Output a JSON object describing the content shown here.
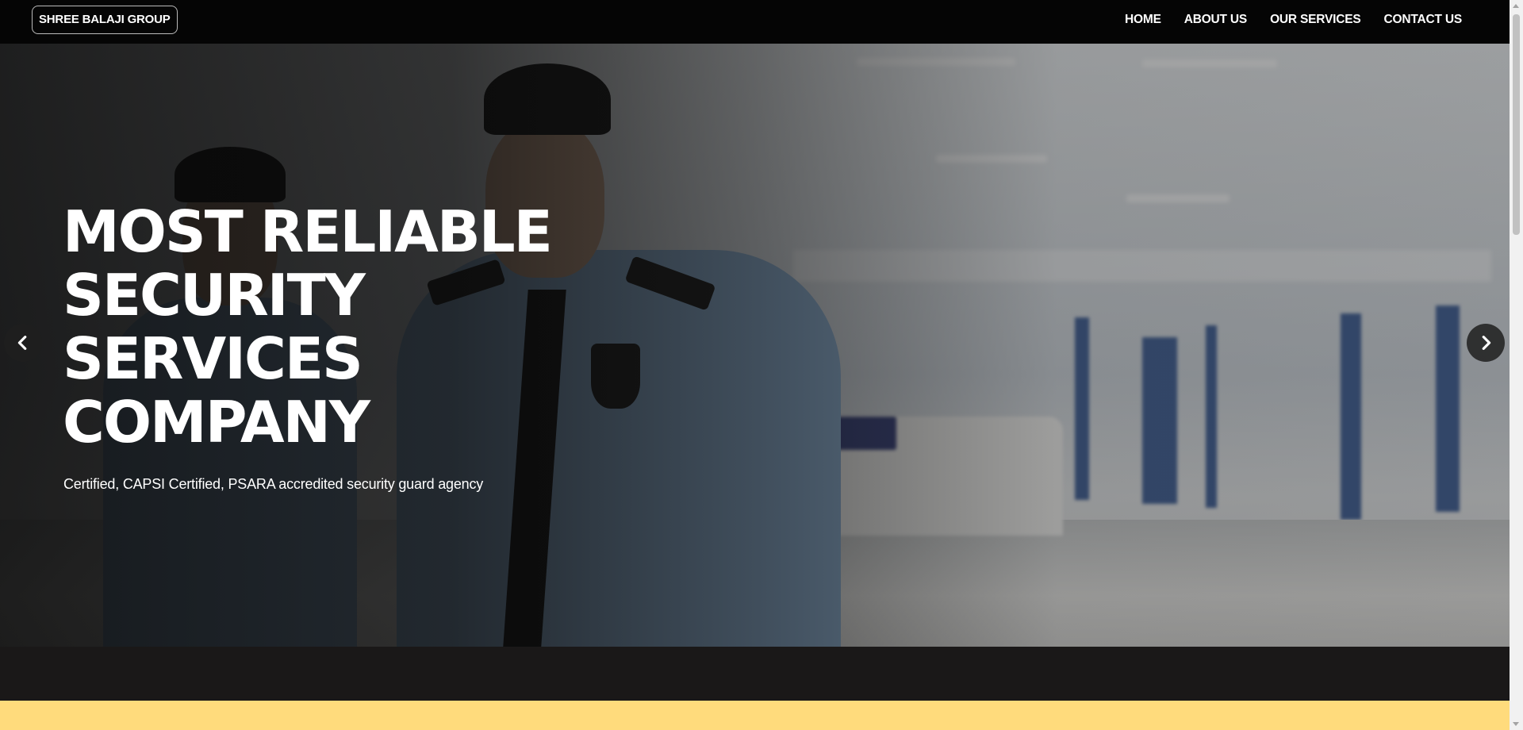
{
  "navbar": {
    "brand": "SHREE BALAJI GROUP",
    "links": [
      "HOME",
      "ABOUT US",
      "OUR SERVICES",
      "CONTACT US"
    ]
  },
  "hero": {
    "title": "MOST RELIABLE SECURITY SERVICES COMPANY",
    "subtitle": "Certified, CAPSI Certified, PSARA accredited security guard agency",
    "prev_icon": "chevron-left-icon",
    "next_icon": "chevron-right-icon"
  },
  "colors": {
    "navbar_bg": "#050505",
    "band_dark": "#1a1818",
    "band_yellow": "#ffdb7c",
    "arrow_bg": "#1e1e1e"
  }
}
